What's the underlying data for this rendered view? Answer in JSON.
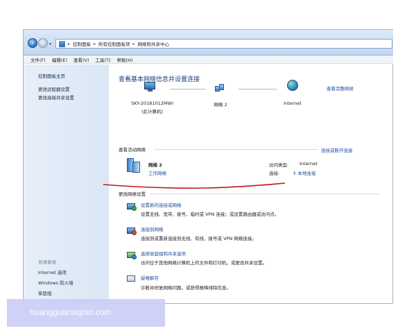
{
  "address": {
    "crumbs": [
      "控制面板",
      "所有控制面板项",
      "网络和共享中心"
    ]
  },
  "menu": [
    "文件(F)",
    "编辑(E)",
    "查看(V)",
    "工具(T)",
    "帮助(H)"
  ],
  "sidebar": {
    "home": "控制面板主页",
    "links": [
      "更改适配器设置",
      "更改高级共享设置"
    ],
    "see_also_title": "另请参阅",
    "see_also": [
      "Internet 选项",
      "Windows 防火墙",
      "家庭组"
    ]
  },
  "main": {
    "title": "查看基本网络信息并设置连接",
    "full_map": "查看完整映射",
    "map": {
      "computer": "SKY-20181012MWI",
      "computer_sub": "(此计算机)",
      "network": "网络 2",
      "internet": "Internet"
    },
    "active_title": "查看活动网络",
    "connect_disconnect": "连接或断开连接",
    "active": {
      "name": "网络 2",
      "type_link": "工作网络",
      "access_label": "访问类型:",
      "access_value": "Internet",
      "conn_label": "连接:",
      "conn_value": "本地连接"
    },
    "change_title": "更改网络设置",
    "tasks": [
      {
        "title": "设置新的连接或网络",
        "desc": "设置无线、宽带、拨号、临时或 VPN 连接；或设置路由器或访问点。"
      },
      {
        "title": "连接到网络",
        "desc": "连接到或重新连接到无线、有线、拨号或 VPN 网络连接。"
      },
      {
        "title": "选择家庭组和共享选项",
        "desc": "访问位于其他网络计算机上的文件和打印机，或更改共享设置。"
      },
      {
        "title": "疑难解答",
        "desc": "诊断并修复网络问题，或获得故障排除信息。"
      }
    ]
  },
  "watermark": "huangguansignin.com",
  "colors": {
    "link": "#1f4ea0",
    "title": "#1a3d7c",
    "annotation": "#c0141a"
  }
}
